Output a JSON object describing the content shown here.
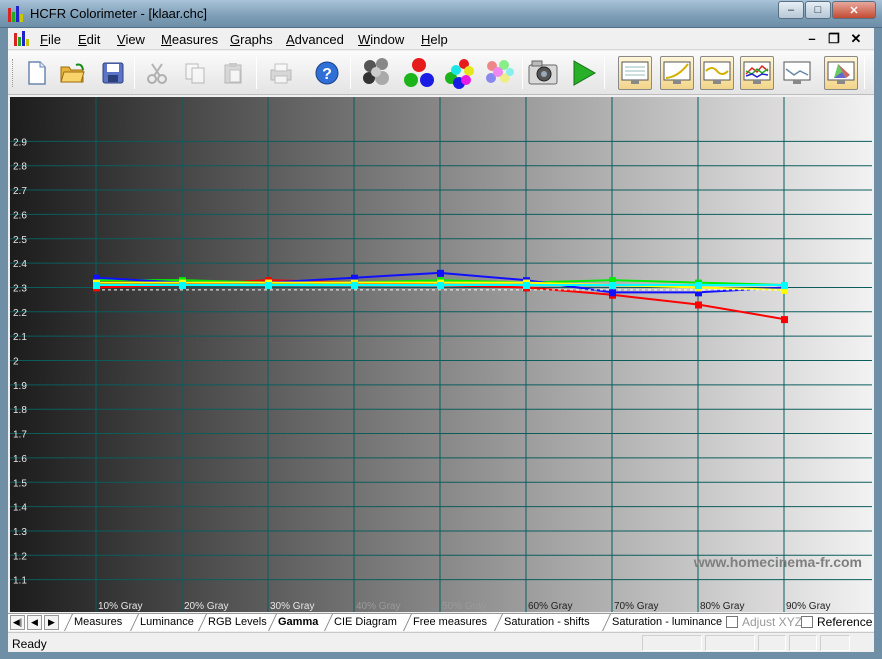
{
  "window": {
    "title": "HCFR Colorimeter - [klaar.chc]"
  },
  "menu": [
    {
      "label": "File",
      "key": "F",
      "rest": "ile"
    },
    {
      "label": "Edit",
      "key": "E",
      "rest": "dit"
    },
    {
      "label": "View",
      "key": "V",
      "rest": "iew"
    },
    {
      "label": "Measures",
      "key": "M",
      "rest": "easures"
    },
    {
      "label": "Graphs",
      "key": "G",
      "rest": "raphs"
    },
    {
      "label": "Advanced",
      "key": "A",
      "rest": "dvanced"
    },
    {
      "label": "Window",
      "key": "W",
      "rest": "indow"
    },
    {
      "label": "Help",
      "key": "H",
      "rest": "elp"
    }
  ],
  "toolbar": {
    "buttons": [
      "new-file-icon",
      "open-folder-icon",
      "save-disk-icon",
      "cut-icon",
      "copy-icon",
      "paste-icon",
      "print-icon",
      "help-icon",
      "gray-scale-measure-icon",
      "primaries-measure-icon",
      "secondaries-measure-icon",
      "saturation-measure-icon",
      "camera-icon",
      "play-icon",
      "data-view-icon",
      "luminance-graph-icon",
      "gamma-graph-icon",
      "rgb-levels-graph-icon",
      "color-temp-graph-icon",
      "cie-diagram-icon"
    ]
  },
  "chart_data": {
    "type": "line",
    "ylim": [
      1.0,
      3.0
    ],
    "y_ticks": [
      "2.9",
      "2.8",
      "2.7",
      "2.6",
      "2.5",
      "2.4",
      "2.3",
      "2.2",
      "2.1",
      "2",
      "1.9",
      "1.8",
      "1.7",
      "1.6",
      "1.5",
      "1.4",
      "1.3",
      "1.2",
      "1.1"
    ],
    "categories": [
      "10% Gray",
      "20% Gray",
      "30% Gray",
      "40% Gray",
      "50% Gray",
      "60% Gray",
      "70% Gray",
      "80% Gray",
      "90% Gray"
    ],
    "grid": true,
    "watermark": "www.homecinema-fr.com",
    "series": [
      {
        "color": "#ff0000",
        "values": [
          2.3,
          2.31,
          2.33,
          2.32,
          2.31,
          2.3,
          2.27,
          2.23,
          2.17
        ]
      },
      {
        "color": "#00ee00",
        "values": [
          2.33,
          2.33,
          2.32,
          2.32,
          2.33,
          2.32,
          2.33,
          2.32,
          2.31
        ]
      },
      {
        "color": "#1010ff",
        "values": [
          2.34,
          2.32,
          2.32,
          2.34,
          2.36,
          2.33,
          2.28,
          2.28,
          2.3
        ]
      },
      {
        "color": "#ffff00",
        "values": [
          2.32,
          2.32,
          2.32,
          2.32,
          2.32,
          2.32,
          2.31,
          2.3,
          2.29
        ]
      },
      {
        "color": "#00ffff",
        "values": [
          2.31,
          2.31,
          2.31,
          2.31,
          2.31,
          2.31,
          2.31,
          2.31,
          2.31
        ]
      },
      {
        "color": "#ffffff",
        "dashed": true,
        "values": [
          2.29,
          2.29,
          2.29,
          2.29,
          2.29,
          2.29,
          2.29,
          2.29,
          2.29
        ]
      }
    ]
  },
  "tabs": {
    "items": [
      "Measures",
      "Luminance",
      "RGB Levels",
      "Gamma",
      "CIE Diagram",
      "Free measures",
      "Saturation - shifts",
      "Saturation - luminance"
    ],
    "active": "Gamma",
    "adjust_xyz": "Adjust XYZ",
    "reference": "Reference"
  },
  "status": {
    "text": "Ready"
  }
}
